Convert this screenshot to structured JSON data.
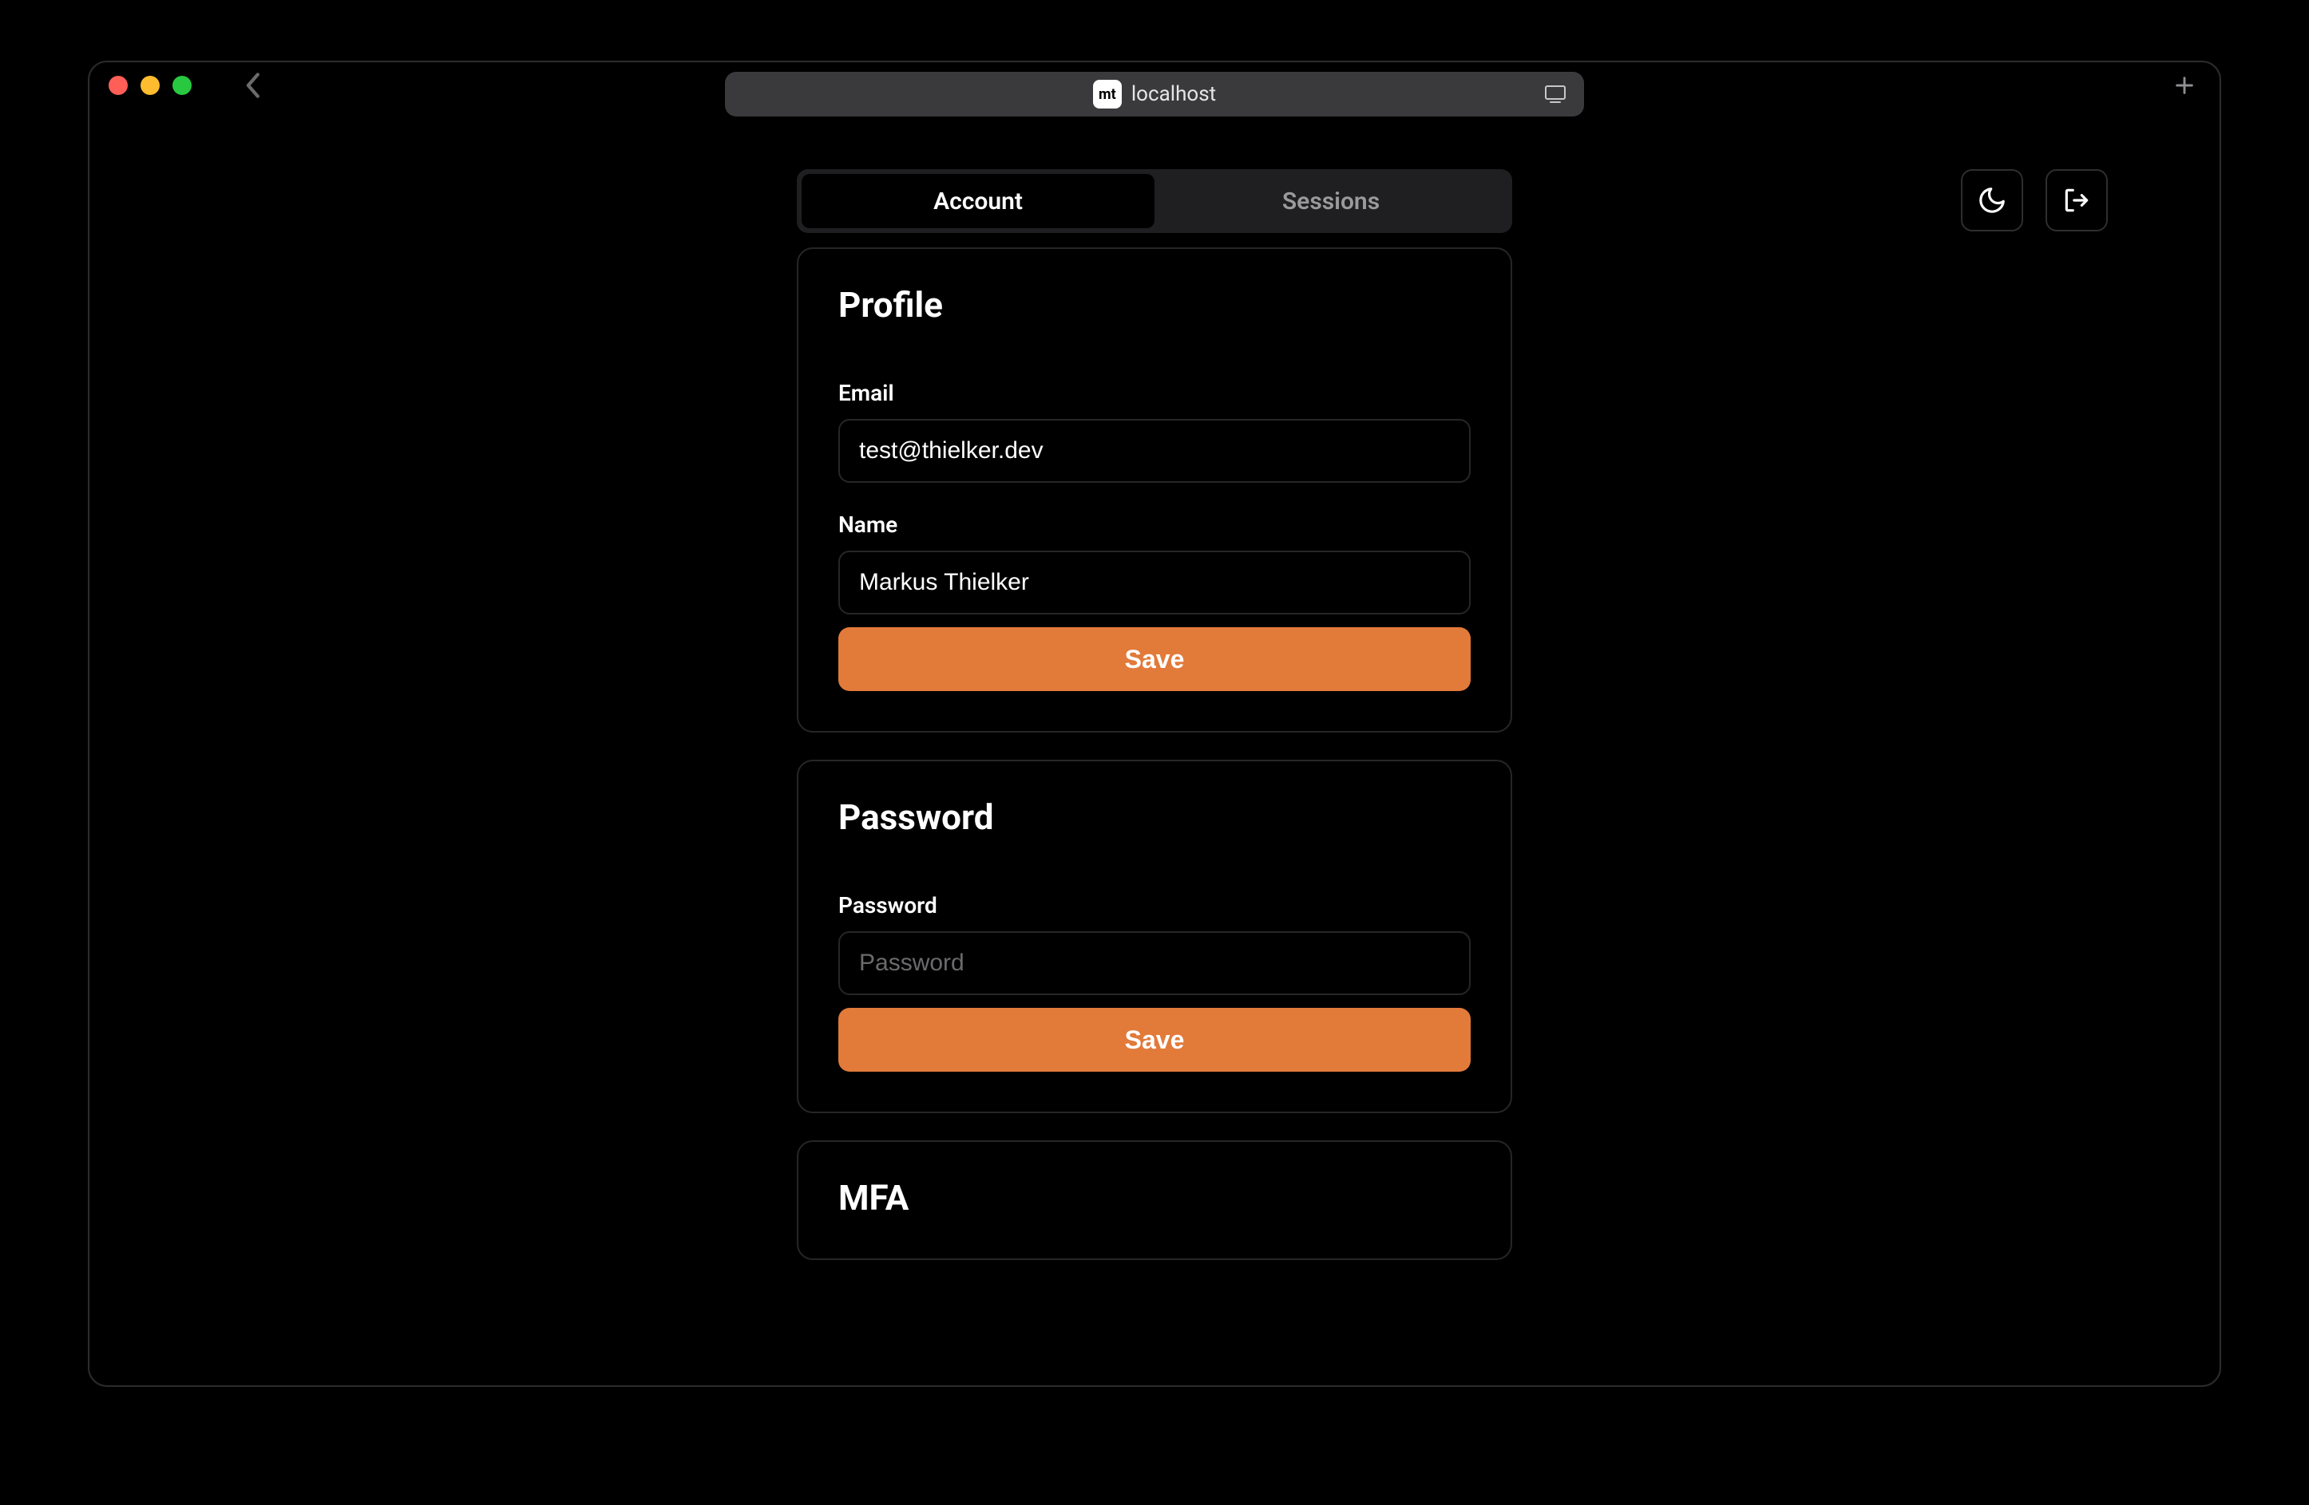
{
  "browser": {
    "address": "localhost"
  },
  "tabs": {
    "account": "Account",
    "sessions": "Sessions"
  },
  "profile": {
    "heading": "Profile",
    "email_label": "Email",
    "email_value": "test@thielker.dev",
    "name_label": "Name",
    "name_value": "Markus Thielker",
    "save_label": "Save"
  },
  "password": {
    "heading": "Password",
    "field_label": "Password",
    "placeholder": "Password",
    "save_label": "Save"
  },
  "mfa": {
    "heading": "MFA"
  }
}
